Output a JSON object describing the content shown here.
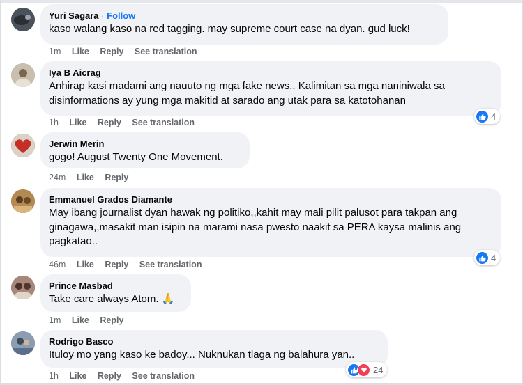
{
  "comments": [
    {
      "author": "Yuri Sagara",
      "follow": "Follow",
      "text": "kaso walang kaso na red tagging. may supreme court case na dyan. gud luck!",
      "time": "1m",
      "like": "Like",
      "reply": "Reply",
      "translate": "See translation",
      "avatar_color": "#5b6470"
    },
    {
      "author": "Iya B Aicrag",
      "text": "Anhirap kasi madami ang nauuto ng mga fake news.. Kalimitan sa mga naniniwala sa disinformations ay yung mga makitid at sarado ang utak para sa katotohanan",
      "time": "1h",
      "like": "Like",
      "reply": "Reply",
      "translate": "See translation",
      "reaction_count": "4",
      "avatar_color": "#a89a86"
    },
    {
      "author": "Jerwin Merin",
      "text": "gogo! August Twenty One Movement.",
      "time": "24m",
      "like": "Like",
      "reply": "Reply",
      "avatar_color": "#c43a2e"
    },
    {
      "author": "Emmanuel Grados Diamante",
      "text": "May ibang journalist dyan hawak ng politiko,,kahit may mali pilit palusot para takpan ang ginagawa,,masakit man isipin na marami nasa pwesto naakit sa PERA kaysa malinis ang pagkatao..",
      "time": "46m",
      "like": "Like",
      "reply": "Reply",
      "translate": "See translation",
      "reaction_count": "4",
      "avatar_color": "#8a6a3c"
    },
    {
      "author": "Prince Masbad",
      "text": "Take care always Atom. 🙏",
      "time": "1m",
      "like": "Like",
      "reply": "Reply",
      "avatar_color": "#7a5d52"
    },
    {
      "author": "Rodrigo Basco",
      "text": "Ituloy mo yang kaso ke badoy... Nuknukan tlaga ng balahura yan..",
      "time": "1h",
      "like": "Like",
      "reply": "Reply",
      "translate": "See translation",
      "reaction_count": "24",
      "avatar_color": "#4b5f7a"
    }
  ],
  "colors": {
    "bubble": "#f0f2f5",
    "link": "#1877f2",
    "meta": "#65676b",
    "like_reaction": "#1877f2",
    "love_reaction": "#f33e58"
  },
  "icons": {
    "like": "thumbs-up-icon",
    "love": "heart-icon"
  }
}
